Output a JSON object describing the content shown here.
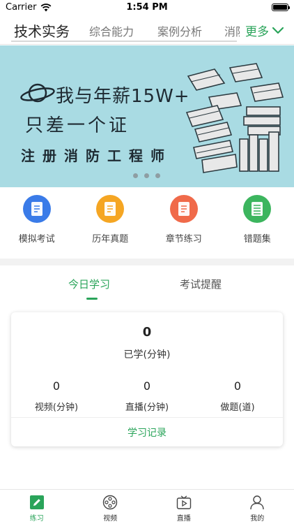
{
  "status_bar": {
    "carrier": "Carrier",
    "time": "1:54 PM"
  },
  "top_tabs": {
    "items": [
      {
        "label": "技术实务"
      },
      {
        "label": "综合能力"
      },
      {
        "label": "案例分析"
      },
      {
        "label": "消防"
      }
    ],
    "active_index": 0,
    "more_label": "更多"
  },
  "banner": {
    "line1": "我与年薪15W+",
    "line2": "只差一个证",
    "line3": "注册消防工程师",
    "page_count": 3
  },
  "actions": [
    {
      "label": "模拟考试",
      "icon": "document-icon",
      "color": "#3a7be8"
    },
    {
      "label": "历年真题",
      "icon": "document-icon",
      "color": "#f5a623"
    },
    {
      "label": "章节练习",
      "icon": "document-icon",
      "color": "#f06a4a"
    },
    {
      "label": "错题集",
      "icon": "list-icon",
      "color": "#3cb55e"
    }
  ],
  "study_tabs": {
    "items": [
      "今日学习",
      "考试提醒"
    ],
    "active_index": 0
  },
  "today": {
    "learned_value": "0",
    "learned_label": "已学(分钟)",
    "stats": [
      {
        "value": "0",
        "label": "视频(分钟)"
      },
      {
        "value": "0",
        "label": "直播(分钟)"
      },
      {
        "value": "0",
        "label": "做题(道)"
      }
    ],
    "record_link": "学习记录"
  },
  "bottom_nav": [
    {
      "label": "练习",
      "icon": "pencil-icon"
    },
    {
      "label": "视频",
      "icon": "film-reel-icon"
    },
    {
      "label": "直播",
      "icon": "tv-play-icon"
    },
    {
      "label": "我的",
      "icon": "user-icon"
    }
  ],
  "colors": {
    "accent": "#2aa45a",
    "banner_bg": "#a9dbe3"
  }
}
